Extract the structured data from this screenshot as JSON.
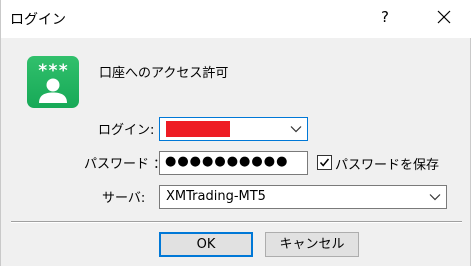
{
  "window": {
    "title": "ログイン",
    "help_label": "?",
    "close_icon": "close-icon"
  },
  "logo": {
    "icon": "user-login-icon",
    "stars": "***",
    "color": "#1fae5b"
  },
  "header": {
    "label": "口座へのアクセス許可"
  },
  "form": {
    "login_label": "ログイン:",
    "password_label": "パスワード ：",
    "password_value": "●●●●●●●●●●",
    "save_password_label": "パスワードを保存",
    "save_password_checked": true,
    "server_label": "サーバ:",
    "server_value": "XMTrading-MT5"
  },
  "buttons": {
    "ok": "OK",
    "cancel": "キャンセル"
  },
  "colors": {
    "focus": "#0078d7",
    "redaction": "#ee1c24"
  }
}
